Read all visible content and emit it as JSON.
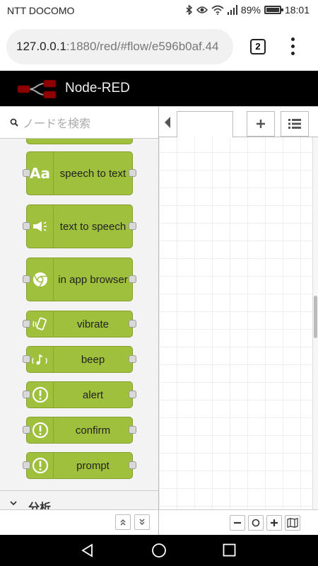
{
  "status_bar": {
    "carrier": "NTT DOCOMO",
    "battery": "89%",
    "battery_level": 0.89,
    "time": "18:01"
  },
  "browser": {
    "url_host": "127.0.0.1",
    "url_rest": ":1880/red/#flow/e596b0af.44",
    "tab_count": "2"
  },
  "header": {
    "title": "Node-RED"
  },
  "palette": {
    "search_placeholder": "ノードを検索",
    "nodes": [
      {
        "label": "speech to text",
        "icon": "text-aa-icon"
      },
      {
        "label": "text to speech",
        "icon": "megaphone-icon"
      },
      {
        "label": "in app browser",
        "icon": "chrome-icon"
      },
      {
        "label": "vibrate",
        "icon": "vibrate-phone-icon"
      },
      {
        "label": "beep",
        "icon": "music-note-icon"
      },
      {
        "label": "alert",
        "icon": "alert-exclamation-icon"
      },
      {
        "label": "confirm",
        "icon": "alert-exclamation-icon"
      },
      {
        "label": "prompt",
        "icon": "alert-exclamation-icon"
      }
    ],
    "category": "分析"
  },
  "colors": {
    "node_green": "#9fc03d",
    "header_bg": "#000000"
  }
}
